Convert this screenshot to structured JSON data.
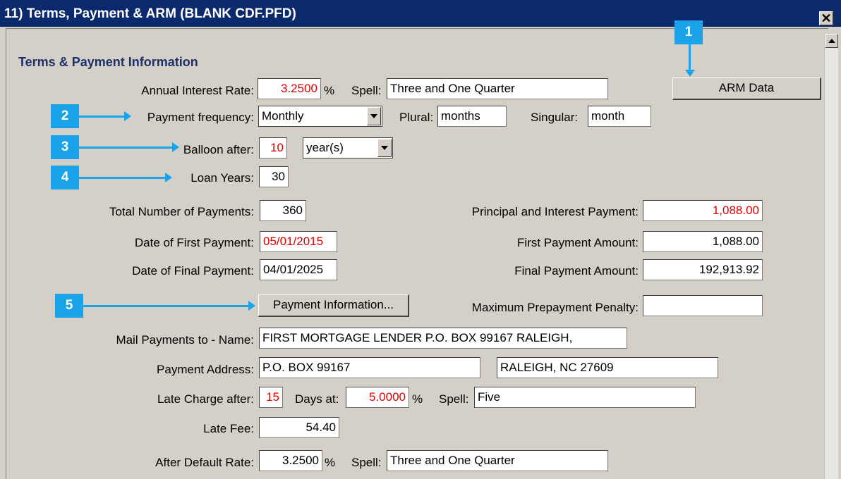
{
  "window": {
    "title": "11) Terms, Payment & ARM (BLANK CDF.PFD)",
    "close_label": "✕"
  },
  "section": {
    "title": "Terms & Payment Information"
  },
  "annual_rate": {
    "label": "Annual Interest Rate:",
    "value": "3.2500",
    "unit": "%",
    "spell_label": "Spell:",
    "spell": "Three and One Quarter"
  },
  "arm_button": {
    "label": "ARM Data"
  },
  "payment_frequency": {
    "label": "Payment frequency:",
    "value": "Monthly",
    "plural_label": "Plural:",
    "plural": "months",
    "singular_label": "Singular:",
    "singular": "month"
  },
  "balloon": {
    "label": "Balloon after:",
    "value": "10",
    "unit": "year(s)"
  },
  "loan_years": {
    "label": "Loan Years:",
    "value": "30"
  },
  "totals": {
    "num_payments_label": "Total Number of Payments:",
    "num_payments": "360",
    "first_date_label": "Date of First Payment:",
    "first_date": "05/01/2015",
    "final_date_label": "Date of Final Payment:",
    "final_date": "04/01/2025",
    "pi_label": "Principal and Interest Payment:",
    "pi": "1,088.00",
    "first_amount_label": "First Payment Amount:",
    "first_amount": "1,088.00",
    "final_amount_label": "Final Payment Amount:",
    "final_amount": "192,913.92"
  },
  "payment_info_button": {
    "label": "Payment Information..."
  },
  "prepayment": {
    "label": "Maximum Prepayment Penalty:",
    "value": ""
  },
  "mail": {
    "name_label": "Mail Payments to - Name:",
    "name": "FIRST MORTGAGE LENDER P.O. BOX 99167 RALEIGH,",
    "address_label": "Payment Address:",
    "address1": "P.O. BOX 99167",
    "address2": "RALEIGH, NC 27609"
  },
  "late_charge": {
    "label": "Late Charge after:",
    "days": "15",
    "days_label": "Days at:",
    "rate": "5.0000",
    "unit": "%",
    "spell_label": "Spell:",
    "spell": "Five"
  },
  "late_fee": {
    "label": "Late Fee:",
    "value": "54.40"
  },
  "default_rate": {
    "label": "After Default Rate:",
    "value": "3.2500",
    "unit": "%",
    "spell_label": "Spell:",
    "spell": "Three and One Quarter"
  },
  "callouts": [
    "1",
    "2",
    "3",
    "4",
    "5"
  ],
  "colors": {
    "title_bar": "#0b2a6e",
    "callout": "#1aa3e8",
    "highlight_text": "#e00000",
    "section_title": "#1c2f6b"
  }
}
